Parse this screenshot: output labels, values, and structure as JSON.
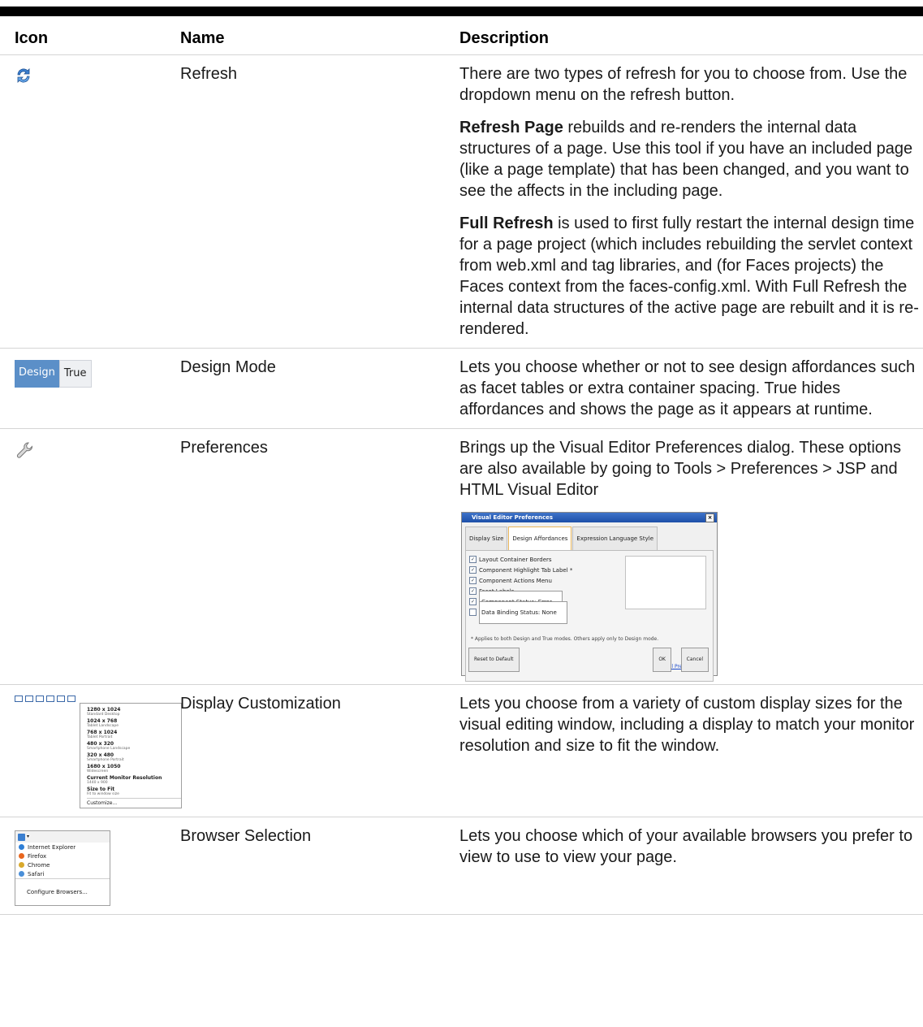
{
  "headers": {
    "icon": "Icon",
    "name": "Name",
    "description": "Description"
  },
  "rows": [
    {
      "icon": "refresh-icon",
      "name": "Refresh",
      "desc1": "There are two types of refresh for you to choose from. Use the dropdown menu on the refresh button.",
      "desc2_bold": "Refresh Page",
      "desc2_rest": " rebuilds and re-renders the internal data structures of a page. Use this tool if you have an included page (like a page template) that has been changed, and you want to see the affects in the including page.",
      "desc3_bold": "Full Refresh",
      "desc3_rest": " is used to first fully restart the internal design time for a page project (which includes rebuilding the servlet context from web.xml and tag libraries, and (for Faces projects) the Faces context from the faces-config.xml. With Full Refresh the internal data structures of the active page are rebuilt and it is re-rendered."
    },
    {
      "icon": "design-mode-toggle",
      "toggle_design": "Design",
      "toggle_true": "True",
      "name": "Design Mode",
      "desc1": "Lets you choose whether or not to see design affordances such as facet tables or extra container spacing. True hides affordances and shows the page as it appears at runtime."
    },
    {
      "icon": "wrench-icon",
      "name": "Preferences",
      "desc1": "Brings up the Visual Editor Preferences dialog. These options are also available by going to Tools > Preferences > JSP and HTML Visual Editor",
      "dialog": {
        "title": "Visual Editor Preferences",
        "tabs": [
          "Display Size",
          "Design Affordances",
          "Expression Language Style"
        ],
        "checkboxes": [
          {
            "label": "Layout Container Borders",
            "checked": true
          },
          {
            "label": "Component Highlight Tab Label *",
            "checked": true
          },
          {
            "label": "Component Actions Menu",
            "checked": true
          },
          {
            "label": "Facet Labels",
            "checked": true
          }
        ],
        "select1": "Component Status: Error",
        "select2": "Data Binding Status: None",
        "note": "* Applies to both Design and True modes. Others apply only to Design mode.",
        "all_prefs": "All Preferences...",
        "reset": "Reset to Default",
        "ok": "OK",
        "cancel": "Cancel"
      }
    },
    {
      "icon": "display-customization-menu",
      "name": "Display Customization",
      "desc1": "Lets you choose from a variety of custom display sizes for the visual editing window, including a display to match your monitor resolution and size to fit the window.",
      "menu": [
        {
          "title": "1280 x 1024",
          "sub": "Standard Desktop"
        },
        {
          "title": "1024 x 768",
          "sub": "Tablet Landscape"
        },
        {
          "title": "768 x 1024",
          "sub": "Tablet Portrait"
        },
        {
          "title": "480 x 320",
          "sub": "Smartphone Landscape"
        },
        {
          "title": "320 x 480",
          "sub": "Smartphone Portrait"
        },
        {
          "title": "1680 x 1050",
          "sub": "Widescreen"
        },
        {
          "title": "Current Monitor Resolution",
          "sub": "1440 x 900"
        },
        {
          "title": "Size to Fit",
          "sub": "Fit to window size"
        },
        {
          "title": "Customize...",
          "sub": ""
        }
      ]
    },
    {
      "icon": "browser-selection-menu",
      "name": "Browser Selection",
      "desc1": "Lets you choose which of your available browsers you prefer to view to use to view your page.",
      "browsers": [
        "Internet Explorer",
        "Firefox",
        "Chrome",
        "Safari"
      ],
      "configure": "Configure Browsers..."
    }
  ]
}
